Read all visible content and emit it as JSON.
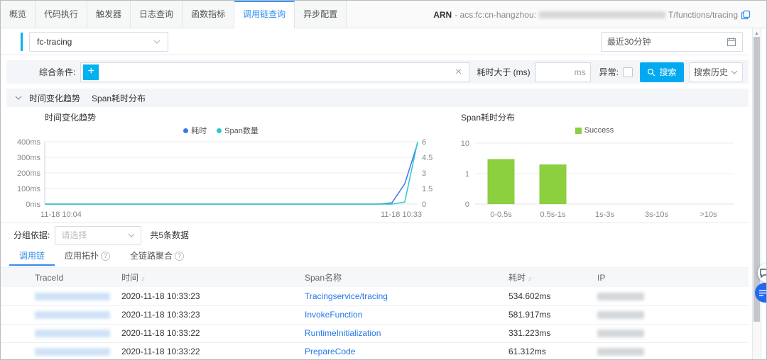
{
  "tabs": {
    "items": [
      "概览",
      "代码执行",
      "触发器",
      "日志查询",
      "函数指标",
      "调用链查询",
      "异步配置"
    ],
    "active_index": 5
  },
  "arn": {
    "label": "ARN",
    "prefix": "- acs:fc:cn-hangzhou:",
    "suffix": "T/functions/tracing"
  },
  "toolbar": {
    "function_select": "fc-tracing",
    "time_range": "最近30分钟"
  },
  "filter": {
    "condition_label": "综合条件:",
    "duration_label": "耗时大于 (ms)",
    "ms_suffix": "ms",
    "exception_label": "异常:",
    "search_label": "搜索",
    "history_label": "搜索历史"
  },
  "section_header": {
    "trend": "时间变化趋势",
    "dist": "Span耗时分布"
  },
  "group": {
    "label": "分组依据:",
    "placeholder": "请选择",
    "count": "共5条数据"
  },
  "subtabs": [
    {
      "label": "调用链",
      "help": false
    },
    {
      "label": "应用拓扑",
      "help": true
    },
    {
      "label": "全链路聚合",
      "help": true
    }
  ],
  "table": {
    "headers": [
      "TraceId",
      "时间",
      "Span名称",
      "耗时",
      "IP"
    ],
    "rows": [
      {
        "time": "2020-11-18 10:33:23",
        "span": "Tracingservice/tracing",
        "duration": "534.602ms"
      },
      {
        "time": "2020-11-18 10:33:23",
        "span": "InvokeFunction",
        "duration": "581.917ms"
      },
      {
        "time": "2020-11-18 10:33:22",
        "span": "RuntimeInitialization",
        "duration": "331.223ms"
      },
      {
        "time": "2020-11-18 10:33:22",
        "span": "PrepareCode",
        "duration": "61.312ms"
      }
    ]
  },
  "chart_data": [
    {
      "type": "line",
      "title": "时间变化趋势",
      "x_labels": [
        "11-18 10:04",
        "11-18 10:33"
      ],
      "left_axis": {
        "ticks": [
          "400ms",
          "300ms",
          "200ms",
          "100ms",
          "0ms"
        ],
        "max": 400
      },
      "right_axis": {
        "ticks": [
          "6",
          "4.5",
          "3",
          "1.5",
          "0"
        ],
        "max": 6
      },
      "series": [
        {
          "name": "耗时",
          "color": "#3b76f2",
          "axis": "left",
          "values": [
            0,
            0,
            0,
            0,
            0,
            0,
            0,
            0,
            0,
            0,
            0,
            0,
            0,
            0,
            0,
            0,
            0,
            0,
            0,
            0,
            0,
            0,
            0,
            0,
            0,
            0,
            0,
            8,
            130,
            390
          ]
        },
        {
          "name": "Span数量",
          "color": "#2ec7c9",
          "axis": "right",
          "values": [
            0,
            0,
            0,
            0,
            0,
            0,
            0,
            0,
            0,
            0,
            0,
            0,
            0,
            0,
            0,
            0,
            0,
            0,
            0,
            0,
            0,
            0,
            0,
            0,
            0,
            0,
            0,
            0,
            0.2,
            6
          ]
        }
      ]
    },
    {
      "type": "bar",
      "title": "Span耗时分布",
      "legend": "Success",
      "color": "#8ccf3f",
      "scale": "log",
      "y_ticks": [
        "10",
        "1",
        "0"
      ],
      "categories": [
        "0-0.5s",
        "0.5s-1s",
        "1s-3s",
        "3s-10s",
        ">10s"
      ],
      "values": [
        3,
        2,
        0,
        0,
        0
      ]
    }
  ]
}
